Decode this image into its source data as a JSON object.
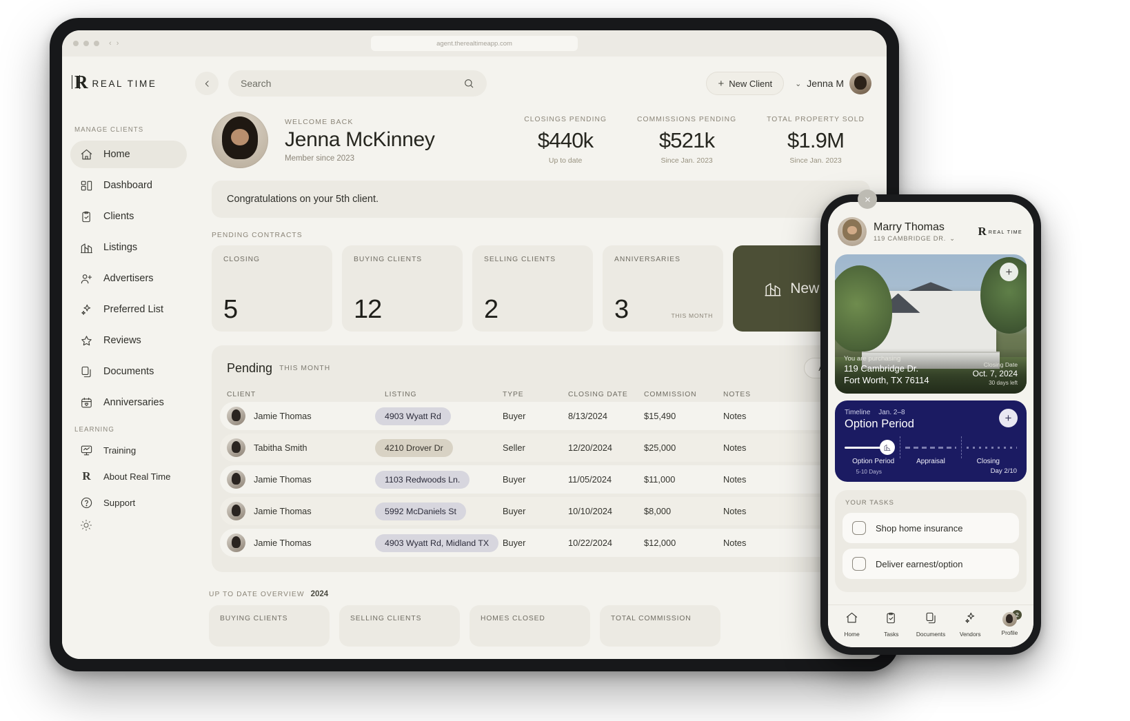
{
  "browser": {
    "url": "agent.therealtimeapp.com"
  },
  "brand": {
    "mark": "R",
    "name": "REAL TIME"
  },
  "sidebar": {
    "section_manage": "MANAGE CLIENTS",
    "section_learning": "LEARNING",
    "items": [
      {
        "label": "Home",
        "icon": "home-icon",
        "active": true
      },
      {
        "label": "Dashboard",
        "icon": "dashboard-icon",
        "active": false
      },
      {
        "label": "Clients",
        "icon": "clipboard-check-icon",
        "active": false
      },
      {
        "label": "Listings",
        "icon": "buildings-icon",
        "active": false
      },
      {
        "label": "Advertisers",
        "icon": "user-plus-icon",
        "active": false
      },
      {
        "label": "Preferred List",
        "icon": "sparkles-icon",
        "active": false
      },
      {
        "label": "Reviews",
        "icon": "star-icon",
        "active": false
      },
      {
        "label": "Documents",
        "icon": "documents-icon",
        "active": false
      },
      {
        "label": "Anniversaries",
        "icon": "calendar-heart-icon",
        "active": false
      }
    ],
    "learning_items": [
      {
        "label": "Training",
        "icon": "training-icon"
      },
      {
        "label": "About Real Time",
        "icon": "realtime-logo-icon"
      },
      {
        "label": "Support",
        "icon": "question-circle-icon"
      }
    ]
  },
  "topbar": {
    "search_placeholder": "Search",
    "new_client_label": "New Client",
    "user_name": "Jenna M"
  },
  "welcome": {
    "kicker": "WELCOME BACK",
    "name": "Jenna McKinney",
    "member_since": "Member since 2023"
  },
  "stats": [
    {
      "label": "CLOSINGS PENDING",
      "value": "$440k",
      "note": "Up to date"
    },
    {
      "label": "COMMISSIONS PENDING",
      "value": "$521k",
      "note": "Since Jan. 2023"
    },
    {
      "label": "TOTAL PROPERTY SOLD",
      "value": "$1.9M",
      "note": "Since Jan. 2023"
    }
  ],
  "banner": {
    "text": "Congratulations on your 5th client."
  },
  "pending_contracts": {
    "kicker": "PENDING CONTRACTS",
    "cards": [
      {
        "label": "CLOSING",
        "value": "5",
        "note": ""
      },
      {
        "label": "BUYING CLIENTS",
        "value": "12",
        "note": ""
      },
      {
        "label": "SELLING CLIENTS",
        "value": "2",
        "note": ""
      },
      {
        "label": "ANNIVERSARIES",
        "value": "3",
        "note": "THIS MONTH"
      }
    ],
    "cta_label": "New Client"
  },
  "pending_table": {
    "title": "Pending",
    "subtitle": "THIS MONTH",
    "filter_label": "All Clients",
    "columns": [
      "CLIENT",
      "LISTING",
      "TYPE",
      "CLOSING DATE",
      "COMMISSION",
      "NOTES"
    ],
    "rows": [
      {
        "client": "Jamie Thomas",
        "listing": "4903 Wyatt Rd",
        "chip": "blue",
        "type": "Buyer",
        "closing_date": "8/13/2024",
        "commission": "$15,490",
        "notes": "Notes",
        "menu": "•••"
      },
      {
        "client": "Tabitha Smith",
        "listing": "4210 Drover Dr",
        "chip": "tan",
        "type": "Seller",
        "closing_date": "12/20/2024",
        "commission": "$25,000",
        "notes": "Notes",
        "menu": "•••"
      },
      {
        "client": "Jamie Thomas",
        "listing": "1103 Redwoods Ln.",
        "chip": "blue",
        "type": "Buyer",
        "closing_date": "11/05/2024",
        "commission": "$11,000",
        "notes": "Notes",
        "menu": "•••"
      },
      {
        "client": "Jamie Thomas",
        "listing": "5992 McDaniels St",
        "chip": "blue",
        "type": "Buyer",
        "closing_date": "10/10/2024",
        "commission": "$8,000",
        "notes": "Notes",
        "menu": "•••"
      },
      {
        "client": "Jamie Thomas",
        "listing": "4903 Wyatt Rd, Midland TX",
        "chip": "blue",
        "type": "Buyer",
        "closing_date": "10/22/2024",
        "commission": "$12,000",
        "notes": "Notes",
        "menu": "•••"
      }
    ]
  },
  "overview": {
    "kicker": "UP TO DATE OVERVIEW",
    "year": "2024",
    "cards": [
      {
        "label": "BUYING CLIENTS"
      },
      {
        "label": "SELLING CLIENTS"
      },
      {
        "label": "HOMES CLOSED"
      },
      {
        "label": "TOTAL COMMISSION"
      }
    ]
  },
  "phone": {
    "header": {
      "name": "Marry Thomas",
      "address": "119 CAMBRIDGE DR.",
      "brand_mark": "R",
      "brand_text": "REAL TIME"
    },
    "property": {
      "kicker": "You are purchasing",
      "line1": "119 Cambridge Dr.",
      "line2": "Fort Worth, TX 76114",
      "closing_label": "Closing Date",
      "closing_date": "Oct. 7, 2024",
      "days_left": "30 days left"
    },
    "timeline": {
      "kicker": "Timeline",
      "range": "Jan. 2–8",
      "title": "Option Period",
      "stages": [
        "Option Period",
        "Appraisal",
        "Closing"
      ],
      "stage_note": "5-10 Days",
      "day_counter": "Day 2/10"
    },
    "tasks": {
      "kicker": "YOUR TASKS",
      "items": [
        "Shop home insurance",
        "Deliver earnest/option"
      ]
    },
    "nav": [
      {
        "label": "Home",
        "icon": "home-icon"
      },
      {
        "label": "Tasks",
        "icon": "tasks-icon"
      },
      {
        "label": "Documents",
        "icon": "documents-icon"
      },
      {
        "label": "Vendors",
        "icon": "sparkles-icon"
      },
      {
        "label": "Profile",
        "icon": "avatar-icon",
        "badge": "2"
      }
    ]
  },
  "colors": {
    "page_bg": "#f4f3ee",
    "card_bg": "#eceae3",
    "accent_olive": "#4c4f36",
    "accent_navy": "#1b1b62",
    "chip_blue": "#d7d6de",
    "chip_tan": "#d8d2c4"
  }
}
